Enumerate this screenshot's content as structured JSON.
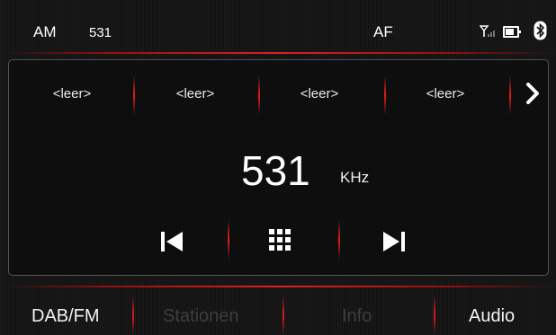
{
  "status_bar": {
    "band": "AM",
    "frequency": "531",
    "af": "AF",
    "signal_icon": "signal-icon",
    "battery_icon": "battery-icon",
    "bluetooth_icon": "bluetooth-icon"
  },
  "presets": [
    {
      "label": "<leer>"
    },
    {
      "label": "<leer>"
    },
    {
      "label": "<leer>"
    },
    {
      "label": "<leer>"
    }
  ],
  "presets_next_icon": "chevron-right-icon",
  "tuner": {
    "frequency": "531",
    "unit": "KHz"
  },
  "controls": {
    "previous_icon": "skip-previous-icon",
    "grid_icon": "grid-icon",
    "next_icon": "skip-next-icon"
  },
  "bottom_bar": [
    {
      "label": "DAB/FM",
      "active": true
    },
    {
      "label": "Stationen",
      "active": false
    },
    {
      "label": "Info",
      "active": false
    },
    {
      "label": "Audio",
      "active": true
    }
  ],
  "colors": {
    "accent": "#d21c1c",
    "background": "#141414",
    "text": "#f2f2f2",
    "disabled_text": "#3e3e3e"
  }
}
